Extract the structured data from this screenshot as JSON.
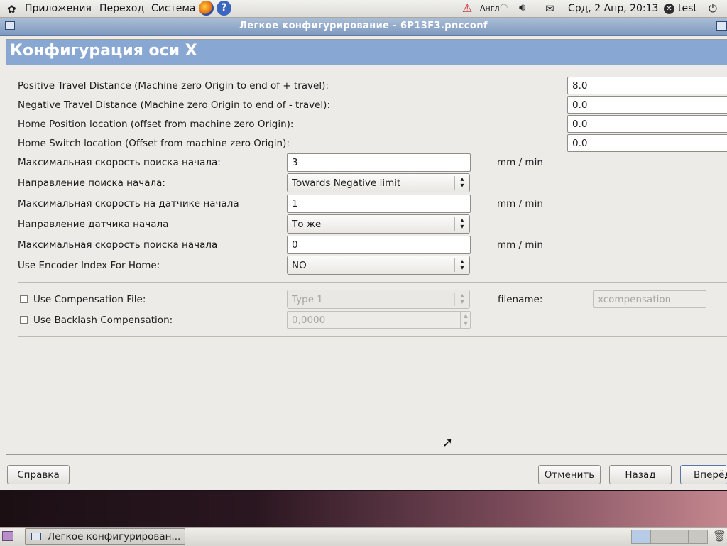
{
  "top_panel": {
    "menus": [
      "Приложения",
      "Переход",
      "Система"
    ],
    "keyboard_layout": "Англ",
    "clock": "Срд,  2 Апр, 20:13",
    "user": "test"
  },
  "window": {
    "title": "Легкое конфигурирование - 6P13F3.pncconf"
  },
  "page": {
    "title": "Конфигурация оси X"
  },
  "form": {
    "positive_travel": {
      "label": "Positive Travel Distance  (Machine zero Origin to end of + travel):",
      "value": "8.0"
    },
    "negative_travel": {
      "label": "Negative Travel Distance  (Machine zero Origin to end of - travel):",
      "value": "0.0"
    },
    "home_position": {
      "label": "Home Position location   (offset from machine zero Origin):",
      "value": "0.0"
    },
    "home_switch": {
      "label": "Home Switch location   (Offset from machine zero Origin):",
      "value": "0.0"
    },
    "search_vel": {
      "label": "Максимальная скорость поиска начала:",
      "value": "3",
      "unit": "mm / min"
    },
    "search_dir": {
      "label": "Направление поиска начала:",
      "value": "Towards Negative limit"
    },
    "latch_vel": {
      "label": "Максимальная скорость на датчике начала",
      "value": "1",
      "unit": "mm / min"
    },
    "latch_dir": {
      "label": "Направление датчика начала",
      "value": "То же"
    },
    "final_vel": {
      "label": "Максимальная скорость поиска начала",
      "value": "0",
      "unit": "mm / min"
    },
    "encoder_index": {
      "label": "Use Encoder Index For Home:",
      "value": "NO"
    }
  },
  "compensation": {
    "comp_file_label": "Use Compensation File:",
    "comp_type": "Type 1",
    "filename_label": "filename:",
    "filename_value": "xcompensation",
    "backlash_label": "Use Backlash Compensation:",
    "backlash_value": "0,0000"
  },
  "buttons": {
    "help": "Справка",
    "cancel": "Отменить",
    "back": "Назад",
    "forward": "Вперёд"
  },
  "taskbar": {
    "task": "Легкое конфигурирован..."
  },
  "colors": {
    "header_band": "#88a7d3",
    "titlebar": "#7f9ac0"
  }
}
